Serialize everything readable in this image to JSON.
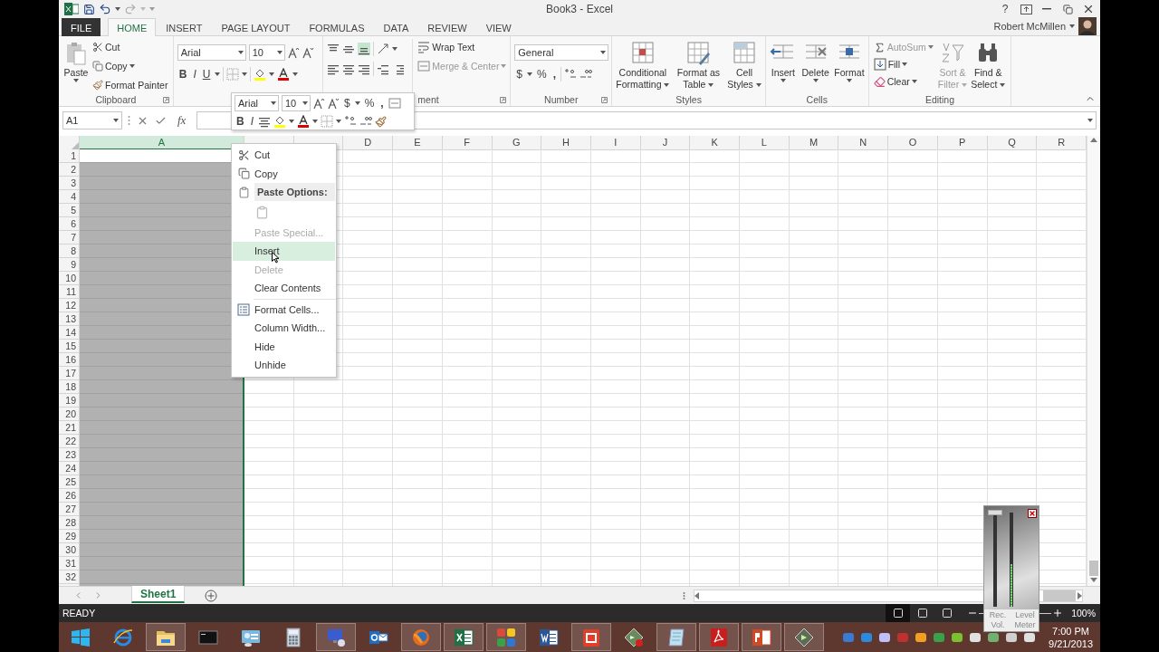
{
  "title_bar": {
    "title": "Book3 - Excel",
    "help": "?"
  },
  "tabs": [
    {
      "label": "FILE",
      "kind": "file",
      "selected": false
    },
    {
      "label": "HOME",
      "kind": "tab",
      "selected": true
    },
    {
      "label": "INSERT",
      "kind": "tab",
      "selected": false
    },
    {
      "label": "PAGE LAYOUT",
      "kind": "tab",
      "selected": false
    },
    {
      "label": "FORMULAS",
      "kind": "tab",
      "selected": false
    },
    {
      "label": "DATA",
      "kind": "tab",
      "selected": false
    },
    {
      "label": "REVIEW",
      "kind": "tab",
      "selected": false
    },
    {
      "label": "VIEW",
      "kind": "tab",
      "selected": false
    }
  ],
  "user": {
    "name": "Robert McMillen"
  },
  "ribbon": {
    "clipboard": {
      "paste": "Paste",
      "cut": "Cut",
      "copy": "Copy",
      "format_painter": "Format Painter",
      "label": "Clipboard"
    },
    "font": {
      "name": "Arial",
      "size": "10",
      "bold": "B",
      "italic": "I",
      "underline": "U"
    },
    "alignment": {
      "wrap_text": "Wrap Text",
      "merge_center": "Merge & Center",
      "label": "ment"
    },
    "number": {
      "format": "General",
      "currency": "$",
      "percent": "%",
      "comma": ",",
      "label": "Number"
    },
    "styles": {
      "buttons": [
        {
          "lines": [
            "Conditional",
            "Formatting"
          ]
        },
        {
          "lines": [
            "Format as",
            "Table"
          ]
        },
        {
          "lines": [
            "Cell",
            "Styles"
          ]
        }
      ],
      "label": "Styles"
    },
    "cells": {
      "buttons": [
        "Insert",
        "Delete",
        "Format"
      ],
      "label": "Cells"
    },
    "editing": {
      "autosum": "AutoSum",
      "fill": "Fill",
      "clear": "Clear",
      "buttons": [
        {
          "lines": [
            "Sort &",
            "Filter"
          ],
          "disabled": true
        },
        {
          "lines": [
            "Find &",
            "Select"
          ],
          "disabled": false
        }
      ],
      "label": "Editing"
    }
  },
  "formula_bar": {
    "name_box": "A1",
    "fx": "fx"
  },
  "mini_toolbar": {
    "font": "Arial",
    "size": "10",
    "currency": "$",
    "percent": "%",
    "comma": ",",
    "bold": "B",
    "italic": "I"
  },
  "columns": [
    {
      "label": "A",
      "selected": true
    },
    {
      "selected": false
    },
    {
      "selected": false
    },
    {
      "label": "D",
      "selected": false
    },
    {
      "label": "E",
      "selected": false
    },
    {
      "label": "F",
      "selected": false
    },
    {
      "label": "G",
      "selected": false
    },
    {
      "label": "H",
      "selected": false
    },
    {
      "label": "I",
      "selected": false
    },
    {
      "label": "J",
      "selected": false
    },
    {
      "label": "K",
      "selected": false
    },
    {
      "label": "L",
      "selected": false
    },
    {
      "label": "M",
      "selected": false
    },
    {
      "label": "N",
      "selected": false
    },
    {
      "label": "O",
      "selected": false
    },
    {
      "label": "P",
      "selected": false
    },
    {
      "label": "Q",
      "selected": false
    },
    {
      "label": "R",
      "selected": false
    }
  ],
  "rows": [
    "1",
    "2",
    "3",
    "4",
    "5",
    "6",
    "7",
    "8",
    "9",
    "10",
    "11",
    "12",
    "13",
    "14",
    "15",
    "16",
    "17",
    "18",
    "19",
    "20",
    "21",
    "22",
    "23",
    "24",
    "25",
    "26",
    "27",
    "28",
    "29",
    "30",
    "31",
    "32"
  ],
  "context_menu": [
    {
      "kind": "item",
      "label": "Cut",
      "disabled": false,
      "selected": false
    },
    {
      "kind": "item",
      "label": "Copy",
      "disabled": false,
      "selected": false
    },
    {
      "kind": "header",
      "label": "Paste Options:"
    },
    {
      "kind": "paste",
      "disabled": true
    },
    {
      "kind": "item",
      "label": "Paste Special...",
      "disabled": true,
      "selected": false
    },
    {
      "kind": "item",
      "label": "Insert",
      "disabled": false,
      "selected": true
    },
    {
      "kind": "item",
      "label": "Delete",
      "disabled": true,
      "selected": false
    },
    {
      "kind": "item",
      "label": "Clear Contents",
      "disabled": false,
      "selected": false
    },
    {
      "kind": "separator"
    },
    {
      "kind": "item",
      "label": "Format Cells...",
      "disabled": false,
      "selected": false
    },
    {
      "kind": "item",
      "label": "Column Width...",
      "disabled": false,
      "selected": false
    },
    {
      "kind": "item",
      "label": "Hide",
      "disabled": false,
      "selected": false
    },
    {
      "kind": "item",
      "label": "Unhide",
      "disabled": false,
      "selected": false
    }
  ],
  "sheet_tabs": [
    {
      "label": "Sheet1",
      "selected": true
    }
  ],
  "status_bar": {
    "status": "READY",
    "views": [
      {
        "selected": true
      },
      {
        "selected": false
      },
      {
        "selected": false
      }
    ],
    "zoom": "100%"
  },
  "recorder": {
    "volume": {
      "label": "Rec. Vol.",
      "level": 1
    },
    "meter": {
      "label": "Level Meter",
      "level": 0.45
    }
  },
  "taskbar": {
    "apps": [
      {
        "kind": "start",
        "running": false
      },
      {
        "kind": "ie",
        "running": false
      },
      {
        "kind": "folder",
        "running": true
      },
      {
        "kind": "cmd",
        "running": false
      },
      {
        "kind": "panel",
        "running": false
      },
      {
        "kind": "calc",
        "running": false
      },
      {
        "kind": "remote",
        "running": true
      },
      {
        "kind": "mail",
        "running": false
      },
      {
        "kind": "firefox",
        "running": true
      },
      {
        "kind": "excel",
        "running": true
      },
      {
        "kind": "tiles",
        "running": true
      },
      {
        "kind": "word",
        "running": false
      },
      {
        "kind": "m",
        "running": true
      },
      {
        "kind": "recorder",
        "running": false
      },
      {
        "kind": "notepad",
        "running": true
      },
      {
        "kind": "pdf",
        "running": true
      },
      {
        "kind": "slides",
        "running": true
      },
      {
        "kind": "green",
        "running": true
      }
    ],
    "time": "7:00 PM",
    "date": "9/21/2013"
  }
}
